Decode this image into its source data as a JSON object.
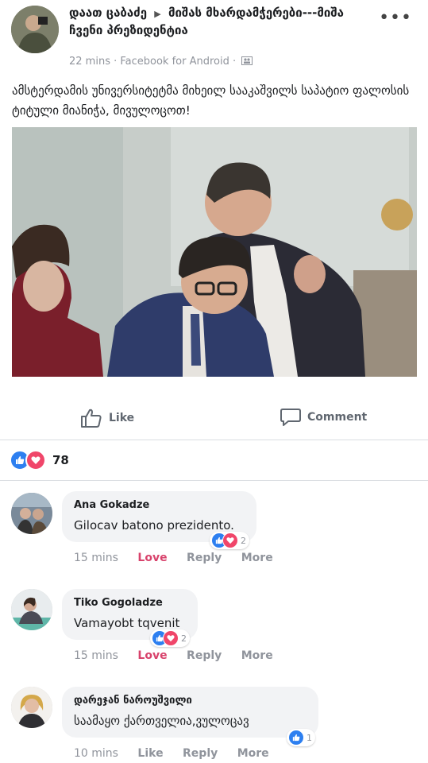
{
  "post": {
    "author": "დაათ ცაბაძე",
    "group": "მიშას მხარდამჭერები---მიშა ჩვენი პრეზიდენტია",
    "meta": "22 mins · Facebook for Android ·",
    "text": "ამსტერდამის უნივერსიტეტმა მიხეილ სააკაშვილს საპატიო ფალოსის ტიტული მიანიჭა, მივულოცოთ!",
    "like_label": "Like",
    "comment_label": "Comment",
    "reaction_count": "78"
  },
  "comments": [
    {
      "name": "Ana Gokadze",
      "text": "Gilocav batono prezidento.",
      "reactions": "2",
      "time": "15 mins",
      "reaction": "Love",
      "reply": "Reply",
      "more": "More"
    },
    {
      "name": "Tiko Gogoladze",
      "text": "Vamayobt tqvenit",
      "reactions": "2",
      "time": "15 mins",
      "reaction": "Love",
      "reply": "Reply",
      "more": "More"
    },
    {
      "name": "დარეჯან ნაროუშვილი",
      "text": "საამაყო ქართველია,ვულოცავ",
      "reactions": "1",
      "time": "10 mins",
      "reaction": "Like",
      "reply": "Reply",
      "more": "More"
    }
  ],
  "icons": {
    "menu": "more-dots-icon",
    "like": "thumbs-up-icon",
    "comment": "speech-bubble-icon",
    "audience": "group-audience-icon"
  },
  "colors": {
    "like_blue": "#2d7ff0",
    "love_red": "#f0466a"
  }
}
